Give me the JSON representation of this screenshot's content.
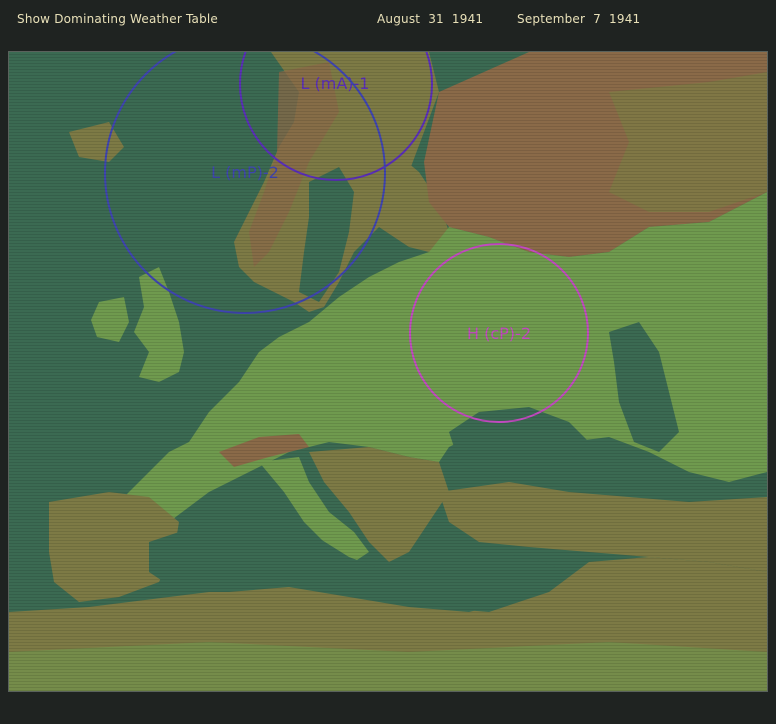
{
  "toolbar": {
    "show_table_label": "Show Dominating Weather Table",
    "date_start": "August  31  1941",
    "date_end": "September  7  1941"
  },
  "colors": {
    "background": "#1f2321",
    "toolbar_text": "#e8e0b8",
    "sea": "#3b6a52",
    "plains": "#6f9a4e",
    "uplands": "#7d7a45",
    "mountains": "#8a6a48",
    "low_ma_system": "#5a2fb8",
    "low_mp_system": "#3f45b0",
    "high_cp_system": "#c24ac0"
  },
  "weather_systems": [
    {
      "id": "low-ma",
      "label": "L (mA)-1",
      "type": "low",
      "air_mass": "maritime arctic",
      "color": "#5a2fb8"
    },
    {
      "id": "low-mp",
      "label": "L (mP)-2",
      "type": "low",
      "air_mass": "maritime polar",
      "color": "#3f45b0"
    },
    {
      "id": "high-cp",
      "label": "H (cP)-2",
      "type": "high",
      "air_mass": "continental polar",
      "color": "#c24ac0"
    }
  ]
}
